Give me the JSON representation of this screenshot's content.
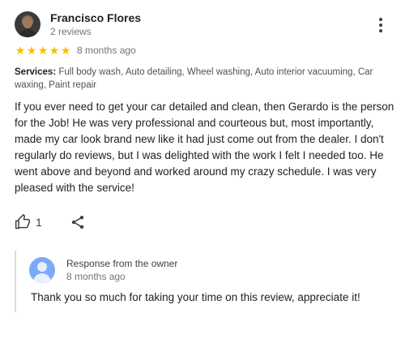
{
  "reviewer": {
    "name": "Francisco Flores",
    "review_count": "2 reviews"
  },
  "rating": {
    "stars": 5,
    "max_stars": 5,
    "date": "8 months ago",
    "star_color": "#fbbc04"
  },
  "services": {
    "label": "Services:",
    "text": "Full body wash, Auto detailing, Wheel washing, Auto interior vacuuming, Car waxing, Paint repair"
  },
  "review_text": "If you ever need to get your car detailed and clean, then Gerardo is the person for the Job! He was very professional and courteous but, most importantly, made my car look brand new like it had just come out from the dealer. I don't regularly do reviews, but I was delighted with the work I felt I needed too. He went above and beyond and worked around my crazy schedule. I was very pleased with the service!",
  "actions": {
    "like_count": "1",
    "like_icon": "thumbs-up-icon",
    "share_icon": "share-icon",
    "more_icon": "more-vert-icon"
  },
  "owner_response": {
    "title": "Response from the owner",
    "date": "8 months ago",
    "text": "Thank you so much for taking your time on this review, appreciate it!"
  }
}
